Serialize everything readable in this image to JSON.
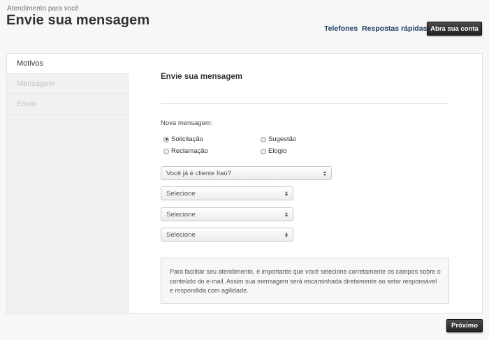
{
  "header": {
    "eyebrow": "Atendimento para você",
    "title": "Envie sua mensagem",
    "links": {
      "phones": "Telefones",
      "quick_answers": "Respostas rápidas"
    },
    "account_button": "Abra sua conta"
  },
  "steps": {
    "motivos": "Motivos",
    "mensagem": "Mensagem",
    "envio": "Envio",
    "active": "Motivos"
  },
  "form": {
    "section_title": "Envie sua mensagem",
    "new_message_label": "Nova mensagem:",
    "options": {
      "solicitacao": "Solicitação",
      "sugestao": "Sugestão",
      "reclamacao": "Reclamação",
      "elogio": "Elogio"
    },
    "selected_option": "Solicitação",
    "selects": {
      "customer": "Você já é cliente Itaú?",
      "select_1": "Selecione",
      "select_2": "Selecione",
      "select_3": "Selecione"
    },
    "info_text": "Para facilitar seu atendimento, é importante que você selecione corretamente os campos sobre o conteúdo do e-mail. Assim sua mensagem será encaminhada diretamente ao setor responsável e respondida com agilidade."
  },
  "footer": {
    "next_button": "Próximo"
  },
  "colors": {
    "link": "#1f3b63",
    "dark_button": "#2b2b2b",
    "sidebar": "#f1f1f1"
  }
}
